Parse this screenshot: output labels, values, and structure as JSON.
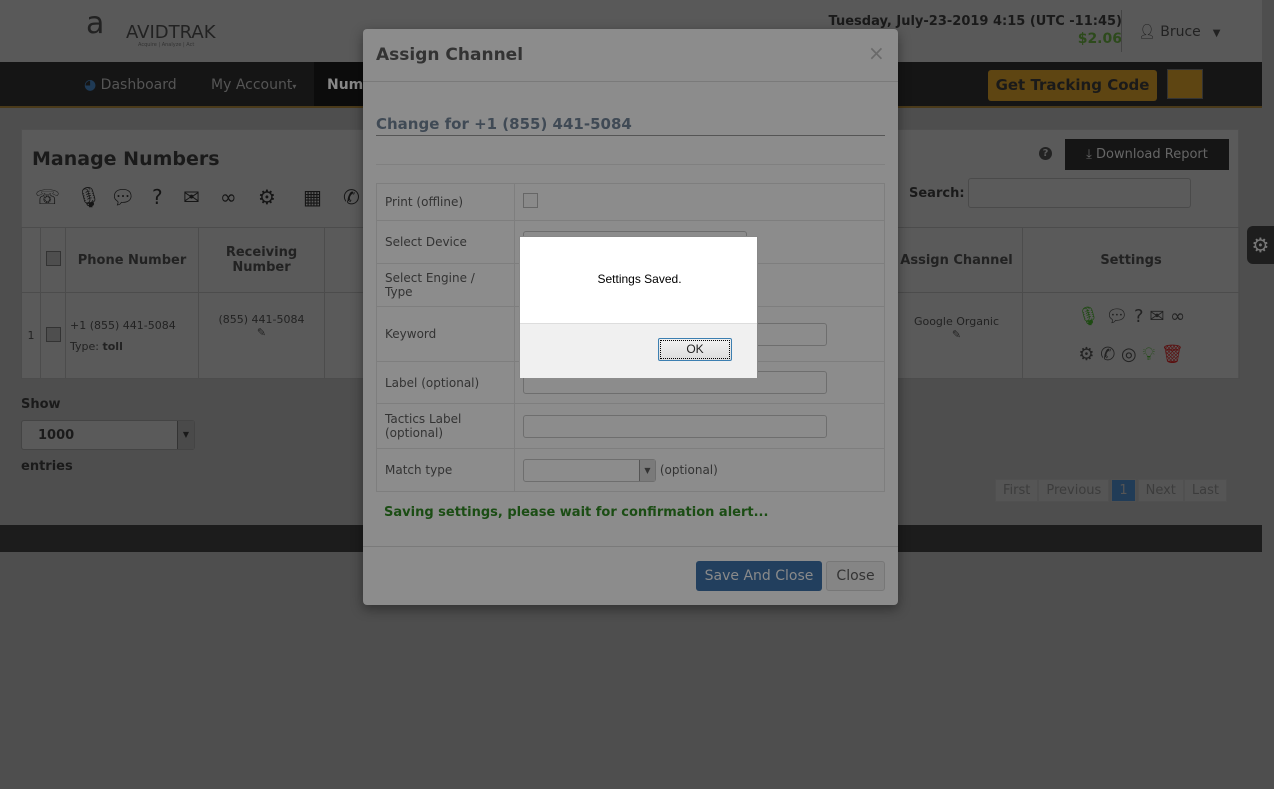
{
  "header": {
    "logo": "AVIDTRAK",
    "logo_tagline": "Acquire | Analyze | Act",
    "datetime": "Tuesday, July-23-2019 4:15 (UTC -11:45)",
    "balance": "$2.06",
    "user": "Bruce"
  },
  "nav": {
    "items": [
      "Dashboard",
      "My Account",
      "Numbers"
    ],
    "tracking_button": "Get Tracking Code"
  },
  "page": {
    "title": "Manage Numbers",
    "download": "Download Report",
    "search_label": "Search:",
    "search_value": "",
    "columns": [
      "Phone Number",
      "Receiving Number",
      "Assign Channel",
      "Settings"
    ],
    "rows": [
      {
        "index": "1",
        "phone": "+1 (855) 441-5084",
        "type_label": "Type:",
        "type": "toll",
        "receiving": "(855) 441-5084",
        "channel": "Google Organic"
      }
    ],
    "show_label": "Show",
    "entries_value": "1000",
    "entries_label": "entries",
    "pager": [
      "First",
      "Previous",
      "1",
      "Next",
      "Last"
    ]
  },
  "modal": {
    "title": "Assign Channel",
    "close": "×",
    "subtitle": "Change for +1 (855) 441-5084",
    "fields": [
      "Print (offline)",
      "Select Device",
      "Select Engine / Type",
      "Keyword",
      "Label (optional)",
      "Tactics Label (optional)",
      "Match type"
    ],
    "match_hint": "(optional)",
    "status": "Saving settings, please wait for confirmation alert...",
    "save_button": "Save And Close",
    "close_button": "Close"
  },
  "alert": {
    "message": "Settings Saved.",
    "ok": "OK"
  },
  "colors": {
    "accent": "#f0a81e",
    "primary": "#2e6da4",
    "success": "#3c9a28"
  }
}
